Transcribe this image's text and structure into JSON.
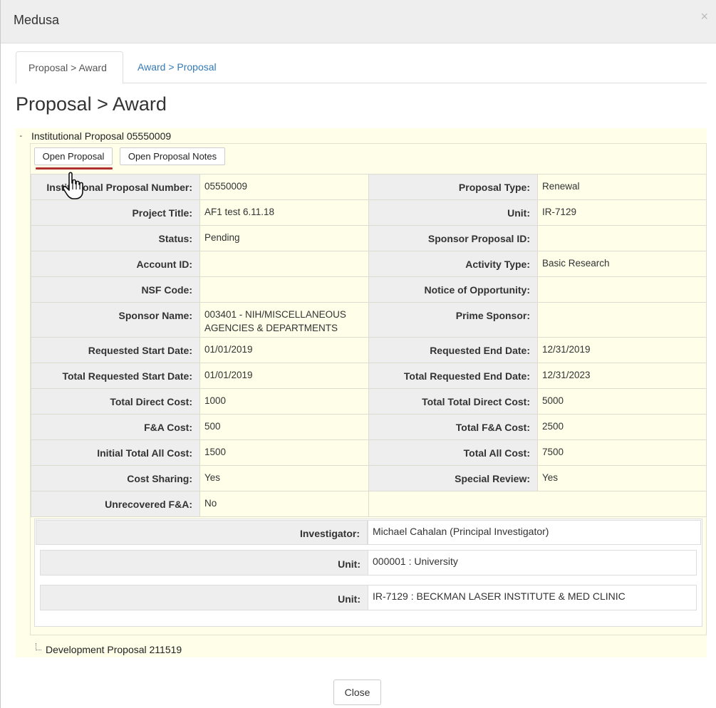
{
  "window": {
    "title": "Medusa",
    "close_glyph": "×"
  },
  "tabs": [
    {
      "label": "Proposal > Award",
      "active": true
    },
    {
      "label": "Award > Proposal",
      "active": false
    }
  ],
  "page_title": "Proposal > Award",
  "tree": {
    "root_expander": "-",
    "root_label": "Institutional Proposal 05550009",
    "buttons": {
      "open_proposal": "Open Proposal",
      "open_notes": "Open Proposal Notes"
    },
    "details": [
      {
        "l1": "Institutional Proposal Number:",
        "v1": "05550009",
        "l2": "Proposal Type:",
        "v2": "Renewal"
      },
      {
        "l1": "Project Title:",
        "v1": "AF1 test 6.11.18",
        "l2": "Unit:",
        "v2": "IR-7129"
      },
      {
        "l1": "Status:",
        "v1": "Pending",
        "l2": "Sponsor Proposal ID:",
        "v2": ""
      },
      {
        "l1": "Account ID:",
        "v1": "",
        "l2": "Activity Type:",
        "v2": "Basic Research"
      },
      {
        "l1": "NSF Code:",
        "v1": "",
        "l2": "Notice of Opportunity:",
        "v2": ""
      },
      {
        "l1": "Sponsor Name:",
        "v1": "003401 - NIH/MISCELLANEOUS AGENCIES & DEPARTMENTS",
        "l2": "Prime Sponsor:",
        "v2": ""
      },
      {
        "l1": "Requested Start Date:",
        "v1": "01/01/2019",
        "l2": "Requested End Date:",
        "v2": "12/31/2019"
      },
      {
        "l1": "Total Requested Start Date:",
        "v1": "01/01/2019",
        "l2": "Total Requested End Date:",
        "v2": "12/31/2023"
      },
      {
        "l1": "Total Direct Cost:",
        "v1": "1000",
        "l2": "Total Total Direct Cost:",
        "v2": "5000"
      },
      {
        "l1": "F&A Cost:",
        "v1": "500",
        "l2": "Total F&A Cost:",
        "v2": "2500"
      },
      {
        "l1": "Initial Total All Cost:",
        "v1": "1500",
        "l2": "Total All Cost:",
        "v2": "7500"
      },
      {
        "l1": "Cost Sharing:",
        "v1": "Yes",
        "l2": "Special Review:",
        "v2": "Yes"
      },
      {
        "l1": "Unrecovered F&A:",
        "v1": "No"
      }
    ],
    "investigator": {
      "label": "Investigator:",
      "value": "Michael Cahalan (Principal Investigator)",
      "units": [
        {
          "label": "Unit:",
          "value": "000001 : University"
        },
        {
          "label": "Unit:",
          "value": "IR-7129 : BECKMAN LASER INSTITUTE & MED CLINIC"
        }
      ]
    },
    "child_label": "Development Proposal 211519"
  },
  "footer": {
    "close_label": "Close"
  },
  "colors": {
    "panel_bg": "#fefee9",
    "label_bg": "#eeeeee",
    "link": "#337ab7",
    "focus_underline": "#b03030"
  }
}
